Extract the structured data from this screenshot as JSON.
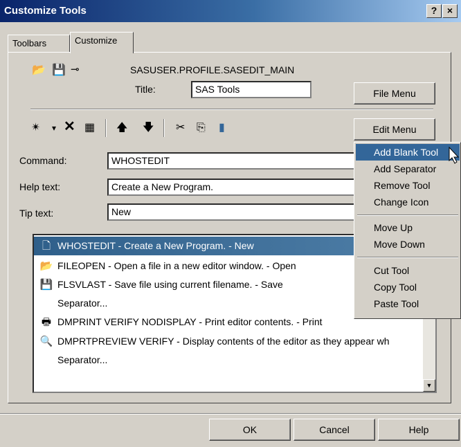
{
  "window": {
    "title": "Customize Tools",
    "help_btn": "?",
    "close_btn": "×"
  },
  "tabs": [
    {
      "label": "Toolbars"
    },
    {
      "label": "Customize"
    }
  ],
  "header": {
    "catalog": "SASUSER.PROFILE.SASEDIT_MAIN",
    "title_label": "Title:",
    "title_value": "SAS Tools",
    "file_menu_btn": "File Menu",
    "edit_menu_btn": "Edit Menu"
  },
  "fields": {
    "command_label": "Command:",
    "command_value": "WHOSTEDIT",
    "help_label": "Help text:",
    "help_value": "Create a New Program.",
    "tip_label": "Tip text:",
    "tip_value": "New"
  },
  "tools": [
    {
      "icon": "new-file-icon",
      "text": "WHOSTEDIT - Create a New Program. - New",
      "selected": true
    },
    {
      "icon": "open-folder-icon",
      "text": "FILEOPEN - Open a file in a new editor window. - Open"
    },
    {
      "icon": "save-disk-icon",
      "text": "FLSVLAST - Save file using current filename. - Save"
    },
    {
      "icon": "",
      "text": "Separator..."
    },
    {
      "icon": "printer-icon",
      "text": "DMPRINT VERIFY NODISPLAY - Print editor contents. - Print"
    },
    {
      "icon": "print-preview-icon",
      "text": "DMPRTPREVIEW VERIFY - Display contents of the editor as they appear wh"
    },
    {
      "icon": "",
      "text": "Separator..."
    }
  ],
  "edit_menu": {
    "items": [
      {
        "label": "Add Blank Tool",
        "highlighted": true
      },
      {
        "label": "Add Separator"
      },
      {
        "label": "Remove Tool"
      },
      {
        "label": "Change Icon"
      },
      {
        "label": "Move Up"
      },
      {
        "label": "Move Down"
      },
      {
        "label": "Cut Tool"
      },
      {
        "label": "Copy Tool"
      },
      {
        "label": "Paste Tool"
      }
    ]
  },
  "footer": {
    "ok": "OK",
    "cancel": "Cancel",
    "help": "Help"
  },
  "colors": {
    "titlebar": "#0a246a",
    "selection": "#336699",
    "face": "#d4d0c8"
  }
}
